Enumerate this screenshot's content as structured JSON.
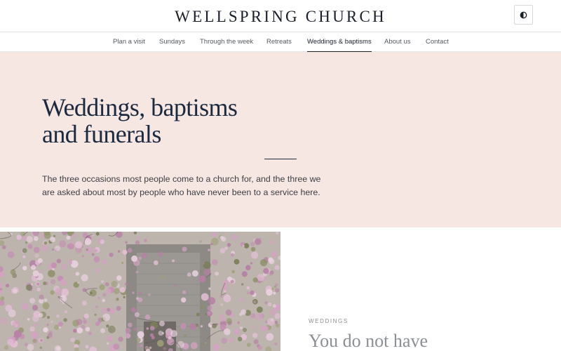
{
  "site": {
    "brand": "WELLSPRING CHURCH",
    "theme_toggle_icon": "contrast-icon"
  },
  "nav": {
    "items": [
      {
        "label": "Plan a visit"
      },
      {
        "label": "Sundays"
      },
      {
        "label": "Through the week"
      },
      {
        "label": "Retreats"
      },
      {
        "label": "Weddings & baptisms",
        "active": true
      },
      {
        "label": "About us"
      },
      {
        "label": "Contact"
      }
    ]
  },
  "hero": {
    "title_line1": "Weddings, baptisms",
    "title_line2": "and funerals",
    "intro": "The three occasions most people come to a church for, and the three we are asked about most by people who have never been to a service here."
  },
  "section": {
    "eyebrow": "WEDDINGS",
    "heading": "You do not have"
  },
  "colors": {
    "hero_bg": "#f6e7e3",
    "heading": "#1c2a40",
    "text": "#3d3f44",
    "nav_text": "#555a60",
    "blossom": "#c89ab8"
  }
}
